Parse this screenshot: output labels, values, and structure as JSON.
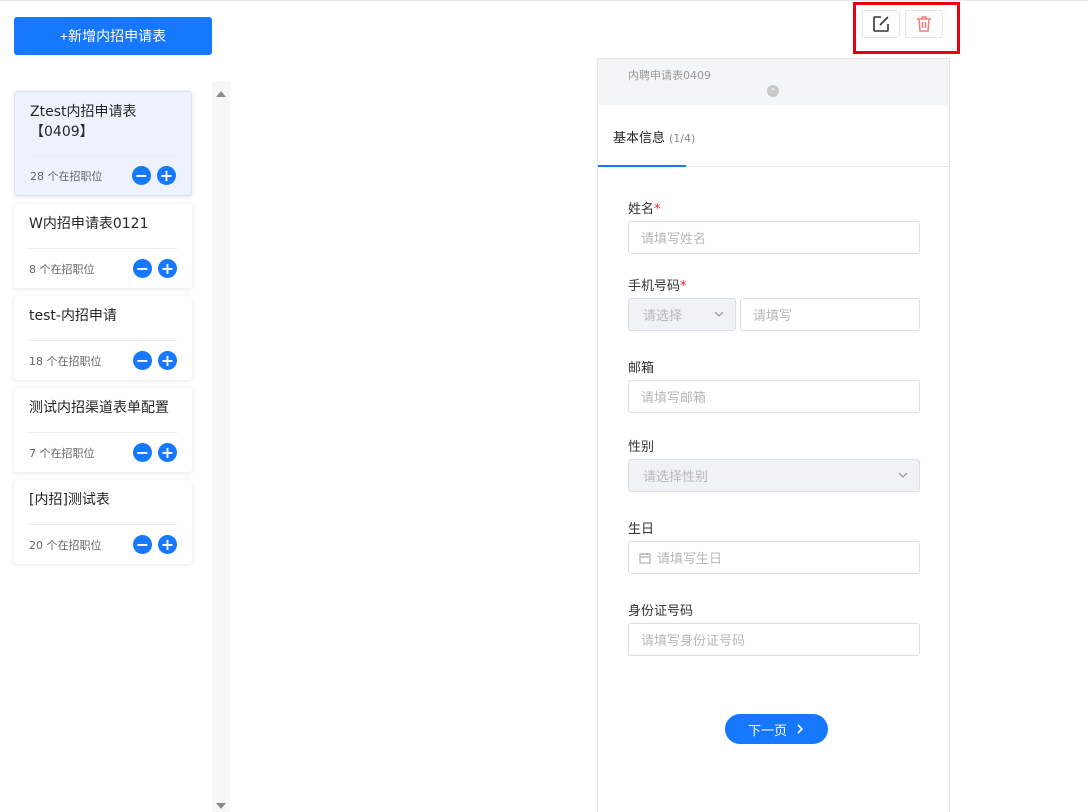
{
  "toolbar": {
    "add_label": "+新增内招申请表",
    "edit_icon": "edit-icon",
    "delete_icon": "trash-icon"
  },
  "forms": [
    {
      "title": "Ztest内招申请表【0409】",
      "count": "28 个在招职位",
      "active": true
    },
    {
      "title": "W内招申请表0121",
      "count": "8 个在招职位",
      "active": false
    },
    {
      "title": "test-内招申请",
      "count": "18 个在招职位",
      "active": false
    },
    {
      "title": "测试内招渠道表单配置",
      "count": "7 个在招职位",
      "active": false
    },
    {
      "title": "[内招]测试表",
      "count": "20 个在招职位",
      "active": false
    }
  ],
  "preview": {
    "title": "内聘申请表0409",
    "tab_label": "基本信息",
    "tab_step": "(1/4)",
    "fields": {
      "name_label": "姓名",
      "name_placeholder": "请填写姓名",
      "phone_label": "手机号码",
      "phone_select_placeholder": "请选择",
      "phone_input_placeholder": "请填写",
      "email_label": "邮箱",
      "email_placeholder": "请填写邮箱",
      "gender_label": "性别",
      "gender_placeholder": "请选择性别",
      "birthday_label": "生日",
      "birthday_placeholder": "请填写生日",
      "id_label": "身份证号码",
      "id_placeholder": "请填写身份证号码"
    },
    "required_mark": "*",
    "next_label": "下一页"
  },
  "colors": {
    "primary": "#1677ff",
    "danger": "#f5222d",
    "highlight": "#e60012"
  }
}
